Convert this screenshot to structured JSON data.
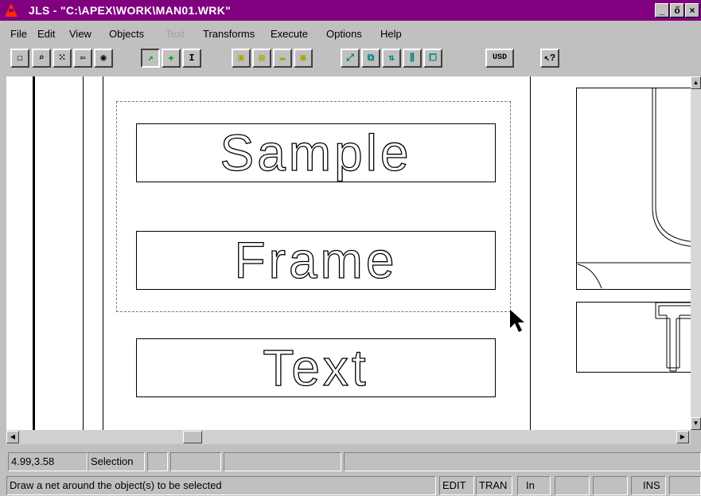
{
  "window": {
    "title": "JLS - \"C:\\APEX\\WORK\\MAN01.WRK\"",
    "minimize": "_",
    "restore": "ő",
    "close": "×"
  },
  "menu": {
    "items": [
      "File",
      "Edit",
      "View",
      "Objects",
      "Text",
      "Transforms",
      "Execute",
      "Options",
      "Help"
    ],
    "disabled": [
      "Text"
    ]
  },
  "toolbar": {
    "buttons": [
      "new-icon",
      "zoom-icon",
      "grid-icon",
      "back-icon",
      "view-icon",
      "select-arrow-icon",
      "add-icon",
      "text-cursor-icon",
      "frame-j-icon",
      "frame-list-icon",
      "line-icon",
      "object-icon",
      "move-icon",
      "resize-icon",
      "flip-icon",
      "align-icon",
      "link-icon",
      "help-pointer-icon"
    ],
    "usd_label": "USD"
  },
  "canvas": {
    "boxes": [
      "Sample",
      "Frame",
      "Text"
    ]
  },
  "status": {
    "coords": "4.99,3.58",
    "mode": "Selection",
    "hint": "Draw a net around the object(s) to be selected",
    "indicators": [
      "EDIT",
      "TRAN",
      "In",
      "",
      "",
      "INS",
      ""
    ]
  },
  "colors": {
    "titlebar": "#800080",
    "background": "#c0c0c0",
    "canvas": "#ffffff"
  }
}
